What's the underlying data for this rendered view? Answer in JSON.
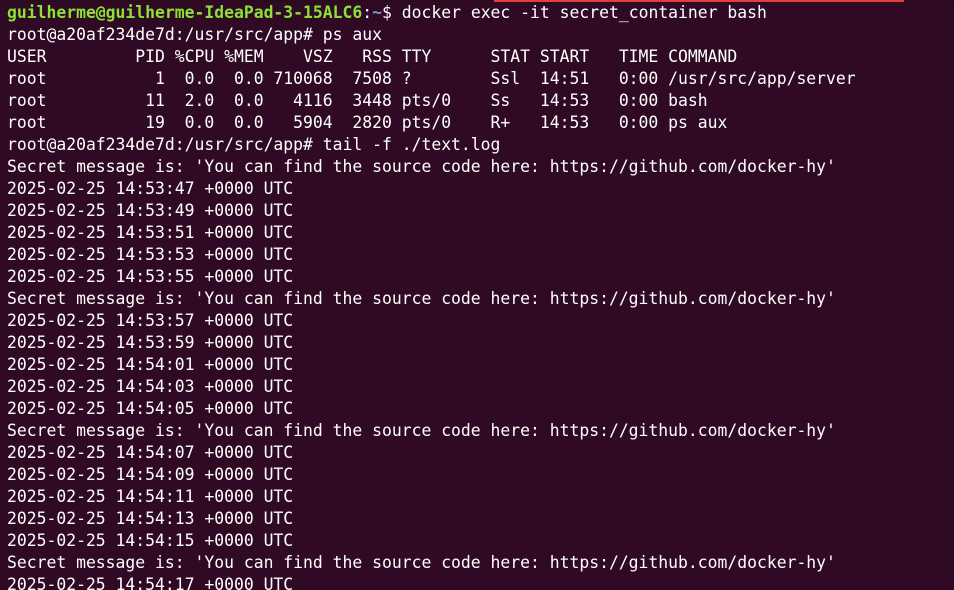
{
  "prompt": {
    "user_host": "guilherme@guilherme-IdeaPad-3-15ALC6",
    "sep": ":",
    "path": "~",
    "symbol": "$ ",
    "command": "docker exec -it secret_container bash"
  },
  "lines": [
    "root@a20af234de7d:/usr/src/app# ps aux",
    "USER         PID %CPU %MEM    VSZ   RSS TTY      STAT START   TIME COMMAND",
    "root           1  0.0  0.0 710068  7508 ?        Ssl  14:51   0:00 /usr/src/app/server",
    "root          11  2.0  0.0   4116  3448 pts/0    Ss   14:53   0:00 bash",
    "root          19  0.0  0.0   5904  2820 pts/0    R+   14:53   0:00 ps aux",
    "root@a20af234de7d:/usr/src/app# tail -f ./text.log",
    "Secret message is: 'You can find the source code here: https://github.com/docker-hy'",
    "2025-02-25 14:53:47 +0000 UTC",
    "2025-02-25 14:53:49 +0000 UTC",
    "2025-02-25 14:53:51 +0000 UTC",
    "2025-02-25 14:53:53 +0000 UTC",
    "2025-02-25 14:53:55 +0000 UTC",
    "Secret message is: 'You can find the source code here: https://github.com/docker-hy'",
    "2025-02-25 14:53:57 +0000 UTC",
    "2025-02-25 14:53:59 +0000 UTC",
    "2025-02-25 14:54:01 +0000 UTC",
    "2025-02-25 14:54:03 +0000 UTC",
    "2025-02-25 14:54:05 +0000 UTC",
    "Secret message is: 'You can find the source code here: https://github.com/docker-hy'",
    "2025-02-25 14:54:07 +0000 UTC",
    "2025-02-25 14:54:09 +0000 UTC",
    "2025-02-25 14:54:11 +0000 UTC",
    "2025-02-25 14:54:13 +0000 UTC",
    "2025-02-25 14:54:15 +0000 UTC",
    "Secret message is: 'You can find the source code here: https://github.com/docker-hy'",
    "2025-02-25 14:54:17 +0000 UTC"
  ],
  "colors": {
    "background": "#300a24",
    "foreground": "#ffffff",
    "prompt_user": "#8ae234",
    "prompt_path": "#729fcf"
  }
}
